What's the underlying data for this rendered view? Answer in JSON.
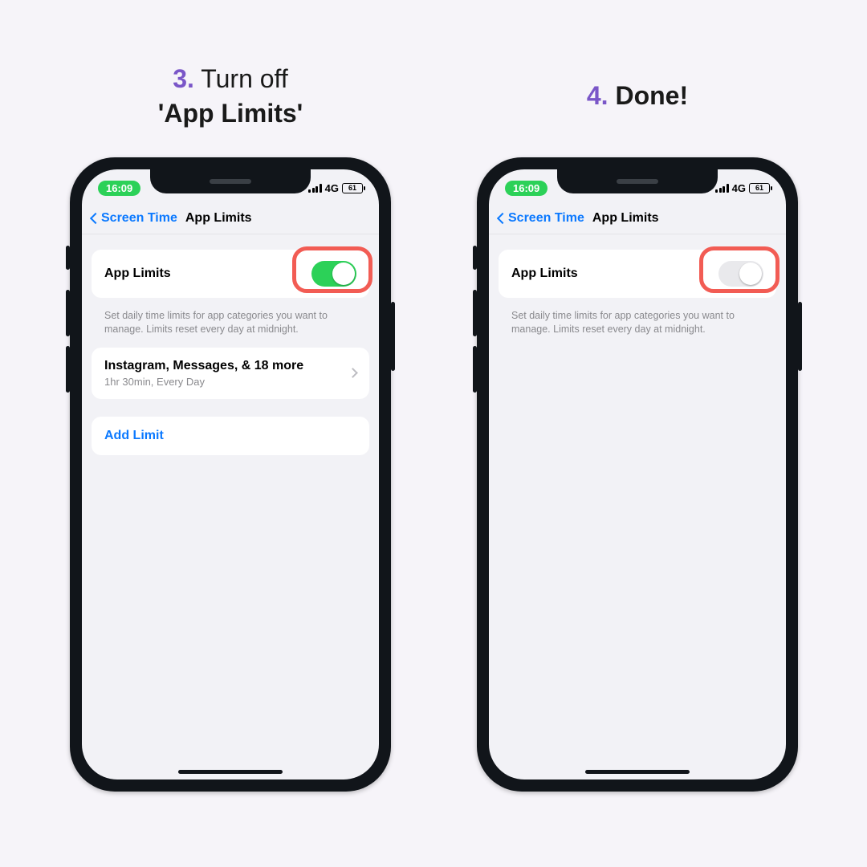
{
  "steps": {
    "left": {
      "num": "3.",
      "line1_rest": " Turn off",
      "line2": "'App Limits'"
    },
    "right": {
      "num": "4.",
      "rest": " Done!"
    }
  },
  "status": {
    "time": "16:09",
    "network": "4G",
    "battery": "61"
  },
  "nav": {
    "back": "Screen Time",
    "title": "App Limits"
  },
  "appLimits": {
    "label": "App Limits",
    "caption": "Set daily time limits for app categories you want to manage. Limits reset every day at midnight."
  },
  "limitItem": {
    "title": "Instagram, Messages, & 18 more",
    "subtitle": "1hr 30min, Every Day"
  },
  "addLimit": "Add Limit"
}
